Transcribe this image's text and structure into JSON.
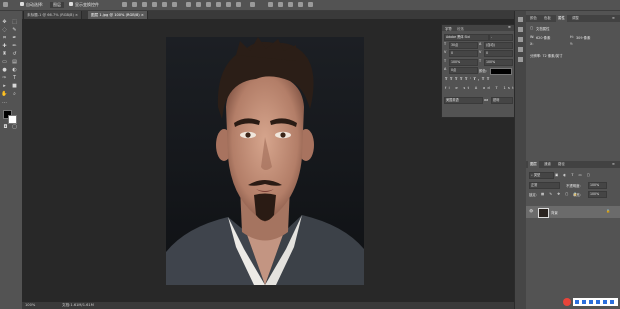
{
  "options_bar": {
    "auto_select_label": "自动选择:",
    "auto_select_value": "图层",
    "transform_label": "显示变换控件"
  },
  "tabs": [
    {
      "label": "未标题-1 @ 66.7% (RGB/8)",
      "active": false
    },
    {
      "label": "图层 1.jpg @ 100% (RGB/8)",
      "active": true
    }
  ],
  "status": {
    "zoom": "100%",
    "doc": "文档:1.61M/1.61M"
  },
  "character_panel": {
    "tabs": [
      "字符",
      "段落"
    ],
    "font_family": "Adobe 黑体 Std",
    "font_style": "-",
    "size": "30点",
    "leading": "(自动)",
    "kerning": "0",
    "tracking": "0",
    "vscale": "100%",
    "hscale": "100%",
    "baseline": "0点",
    "color_label": "颜色:",
    "lang": "美国英语",
    "aa": "锐利"
  },
  "props_panel": {
    "tabs": [
      "颜色",
      "色板",
      "属性",
      "调整"
    ],
    "title": "文档属性",
    "w_label": "W:",
    "w_value": "620 像素",
    "h_label": "H:",
    "h_value": "309 像素",
    "x_label": "X:",
    "y_label": "Y:",
    "res": "分辨率: 72 像素/英寸"
  },
  "layers_panel": {
    "tabs": [
      "图层",
      "通道",
      "路径"
    ],
    "kind": "类型",
    "mode": "正常",
    "opacity_label": "不透明度:",
    "opacity": "100%",
    "lock_label": "锁定:",
    "fill_label": "填充:",
    "fill": "100%",
    "layer_name": "背景"
  },
  "colors": {
    "fg": "#000000",
    "bg": "#ffffff",
    "accent": "#2d6fdc"
  }
}
